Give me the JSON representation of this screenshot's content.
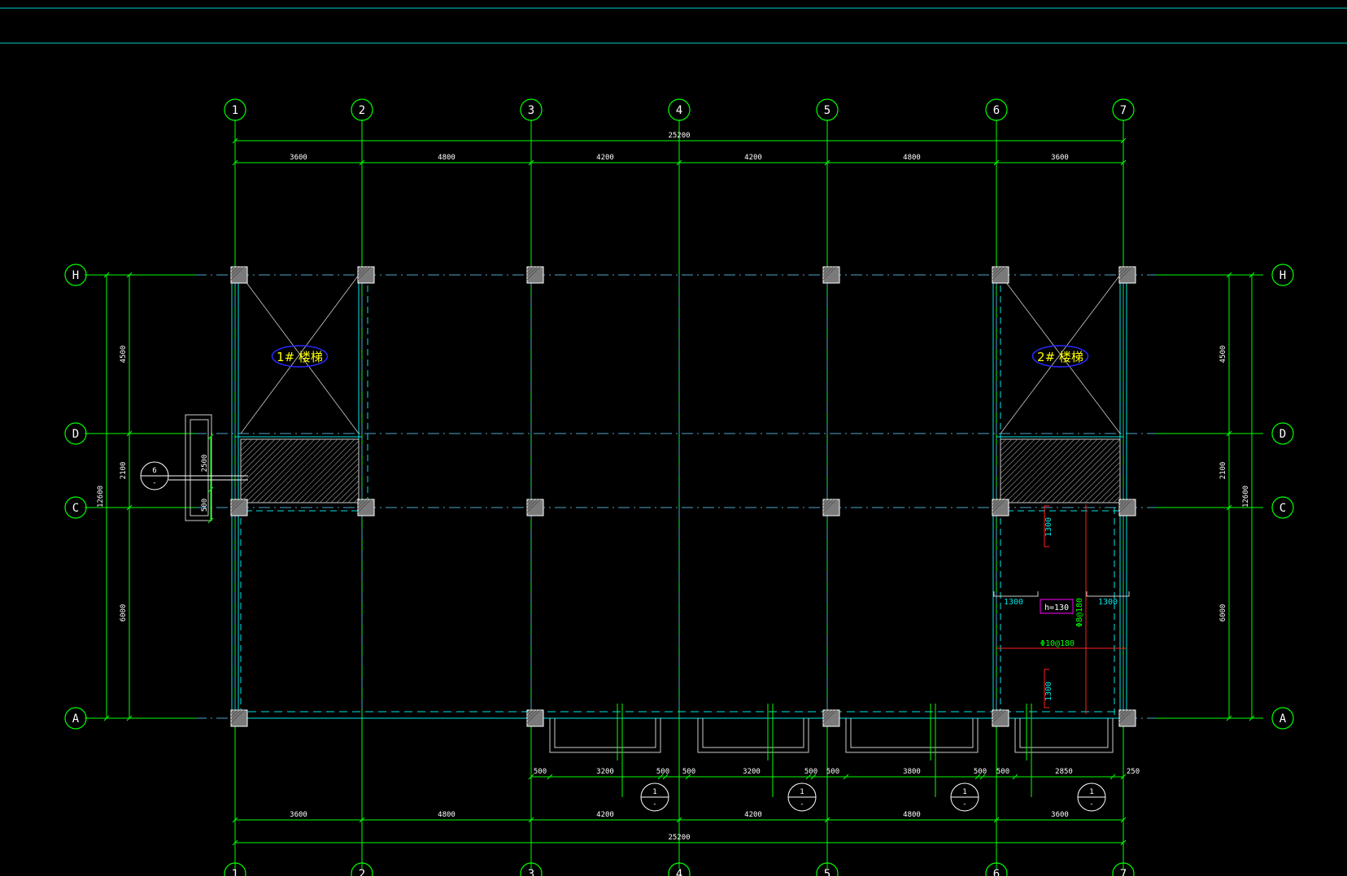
{
  "colors": {
    "background": "#000000",
    "grid": "#00ff00",
    "axis_line": "#4aa8c8",
    "wall": "#00e5e5",
    "column_fill": "#7a7a7a",
    "white": "#ffffff",
    "stair_label": "#ffff00",
    "stair_ellipse": "#2a2aff",
    "rebar": "#ff2020",
    "rebar_label": "#00ff00",
    "slab_tag": "#ff00ff",
    "header_line": "#00cccc"
  },
  "axes": {
    "columns": [
      "1",
      "2",
      "3",
      "4",
      "5",
      "6",
      "7"
    ],
    "rows": [
      "H",
      "D",
      "C",
      "A"
    ]
  },
  "dimensions": {
    "top_total": "25200",
    "top_spans": [
      "3600",
      "4800",
      "4200",
      "4200",
      "4800",
      "3600"
    ],
    "bottom_total": "25200",
    "bottom_spans": [
      "3600",
      "4800",
      "4200",
      "4200",
      "4800",
      "3600"
    ],
    "left_spans": [
      "4500",
      "2100",
      "6000"
    ],
    "left_total": "12600",
    "right_spans": [
      "4500",
      "2100",
      "6000"
    ],
    "right_total": "12600",
    "entrance_dims": [
      "2500",
      "500"
    ],
    "bottom_detail": [
      "500",
      "3200",
      "500",
      "500",
      "3200",
      "500",
      "500",
      "3800",
      "500",
      "500",
      "2850",
      "250"
    ]
  },
  "stairs": [
    {
      "label": "1# 楼梯"
    },
    {
      "label": "2# 楼梯"
    }
  ],
  "section_marks": [
    {
      "number": "6",
      "sheet": "-"
    },
    {
      "number": "1",
      "sheet": "-"
    },
    {
      "number": "1",
      "sheet": "-"
    },
    {
      "number": "1",
      "sheet": "-"
    },
    {
      "number": "1",
      "sheet": "-"
    }
  ],
  "slab_detail": {
    "thickness": "h=130",
    "rebar_vertical": "Φ8@180",
    "rebar_horizontal": "Φ10@180",
    "len_top": "1300",
    "len_bottom": "1300",
    "len_left": "1300",
    "len_right": "1300"
  }
}
